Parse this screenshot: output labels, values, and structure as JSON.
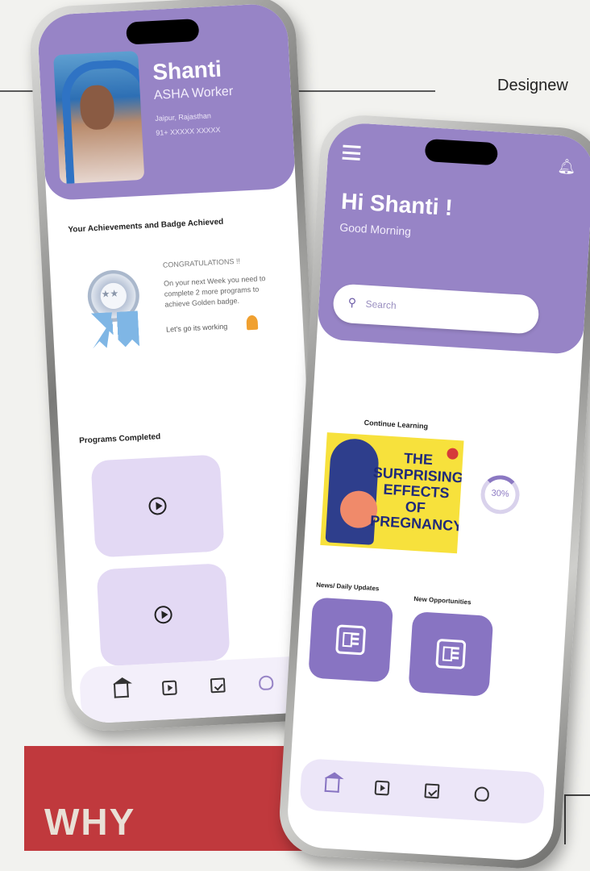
{
  "brand": {
    "text": "Designew"
  },
  "banner": {
    "text": "WHY"
  },
  "profile_screen": {
    "name": "Shanti",
    "role": "ASHA Worker",
    "location": "Jaipur, Rajasthan",
    "phone": "91+ XXXXX XXXXX",
    "achievements_title": "Your Achievements and Badge Achieved",
    "congrats": "CONGRATULATIONS !!",
    "achievement_message": "On your next Week you need to complete 2 more programs to achieve Golden badge.",
    "cta": "Let's go its working",
    "programs_title": "Programs Completed",
    "nav": [
      "home-icon",
      "video-icon",
      "calendar-icon",
      "hand-icon"
    ]
  },
  "home_screen": {
    "greeting": "Hi Shanti !",
    "subgreeting": "Good Morning",
    "search_placeholder": "Search",
    "continue_title": "Continue Learning",
    "course_title": "THE SURPRISING EFFECTS OF PREGNANCY",
    "progress_label": "30%",
    "progress": 0.3,
    "news_label": "News/ Daily Updates",
    "opportunities_label": "New Opportunities",
    "nav": [
      "home-icon",
      "video-icon",
      "calendar-icon",
      "hand-icon"
    ]
  },
  "colors": {
    "accent": "#9784c6",
    "banner": "#c0393d",
    "course_bg": "#f7e13c"
  }
}
